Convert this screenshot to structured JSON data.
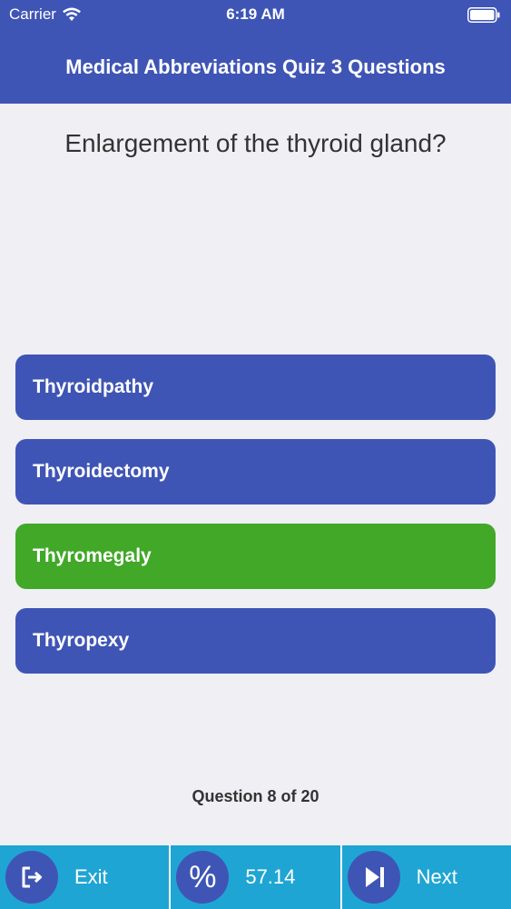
{
  "status_bar": {
    "carrier": "Carrier",
    "time": "6:19 AM",
    "wifi_icon": "wifi-icon",
    "battery_icon": "battery-icon"
  },
  "nav": {
    "title": "Medical Abbreviations Quiz 3 Questions"
  },
  "quiz": {
    "question": "Enlargement of the thyroid gland?",
    "answers": [
      {
        "label": "Thyroidpathy",
        "state": "default"
      },
      {
        "label": "Thyroidectomy",
        "state": "default"
      },
      {
        "label": "Thyromegaly",
        "state": "correct"
      },
      {
        "label": "Thyropexy",
        "state": "default"
      }
    ],
    "progress": "Question 8 of 20"
  },
  "toolbar": {
    "exit_label": "Exit",
    "exit_icon": "exit-icon",
    "score_symbol": "%",
    "score_value": "57.14",
    "next_label": "Next",
    "next_icon": "skip-next-icon"
  },
  "colors": {
    "primary": "#3f55b5",
    "correct": "#41a828",
    "toolbar": "#1fa5d3",
    "background": "#efeff4"
  }
}
